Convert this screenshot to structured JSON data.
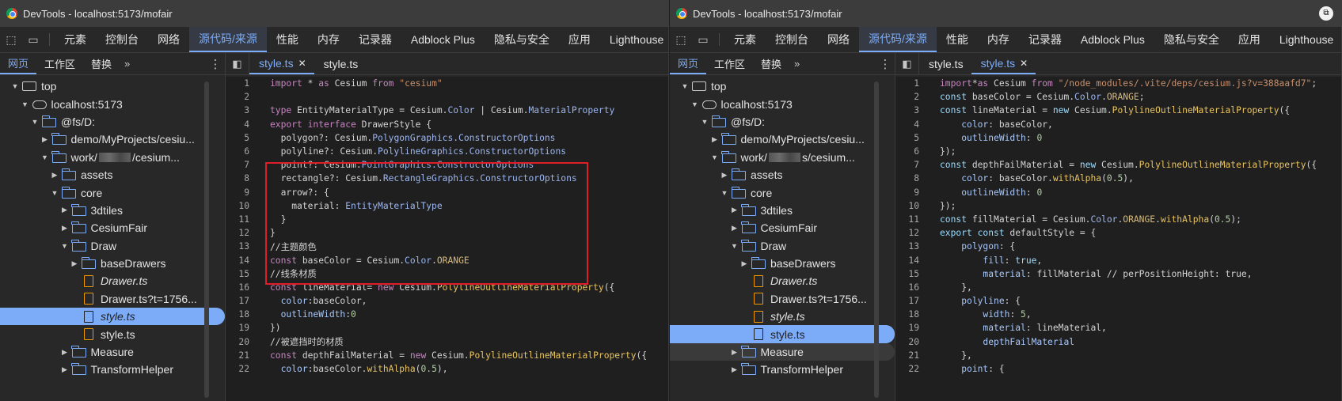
{
  "windows": [
    {
      "title": "DevTools - localhost:5173/mofair",
      "main_tabs": [
        "元素",
        "控制台",
        "网络",
        "源代码/来源",
        "性能",
        "内存",
        "记录器",
        "Adblock Plus",
        "隐私与安全",
        "应用",
        "Lighthouse"
      ],
      "active_main_tab": 3,
      "nav_tabs": [
        "网页",
        "工作区",
        "替换"
      ],
      "nav_more": "»",
      "tree": [
        {
          "indent": 0,
          "arrow": "▼",
          "icon": "frame",
          "label": "top"
        },
        {
          "indent": 1,
          "arrow": "▼",
          "icon": "cloud",
          "label": "localhost:5173"
        },
        {
          "indent": 2,
          "arrow": "▼",
          "icon": "folder",
          "label": "@fs/D:"
        },
        {
          "indent": 3,
          "arrow": "▶",
          "icon": "folder",
          "label": "demo/MyProjects/cesiu..."
        },
        {
          "indent": 3,
          "arrow": "▼",
          "icon": "folder",
          "label": "work/",
          "label_suffix": "/cesium...",
          "blurred": true
        },
        {
          "indent": 4,
          "arrow": "▶",
          "icon": "folder",
          "label": "assets"
        },
        {
          "indent": 4,
          "arrow": "▼",
          "icon": "folder",
          "label": "core"
        },
        {
          "indent": 5,
          "arrow": "▶",
          "icon": "folder",
          "label": "3dtiles"
        },
        {
          "indent": 5,
          "arrow": "▶",
          "icon": "folder",
          "label": "CesiumFair"
        },
        {
          "indent": 5,
          "arrow": "▼",
          "icon": "folder",
          "label": "Draw"
        },
        {
          "indent": 6,
          "arrow": "▶",
          "icon": "folder",
          "label": "baseDrawers"
        },
        {
          "indent": 6,
          "arrow": "",
          "icon": "file",
          "label": "Drawer.ts",
          "italic": true
        },
        {
          "indent": 6,
          "arrow": "",
          "icon": "file",
          "label": "Drawer.ts?t=1756..."
        },
        {
          "indent": 6,
          "arrow": "",
          "icon": "file",
          "label": "style.ts",
          "italic": true,
          "selected": true
        },
        {
          "indent": 6,
          "arrow": "",
          "icon": "file",
          "label": "style.ts"
        },
        {
          "indent": 5,
          "arrow": "▶",
          "icon": "folder",
          "label": "Measure"
        },
        {
          "indent": 5,
          "arrow": "▶",
          "icon": "folder",
          "label": "TransformHelper"
        }
      ],
      "editor_tabs": [
        {
          "label": "style.ts",
          "active": true,
          "closable": true
        },
        {
          "label": "style.ts",
          "active": false,
          "closable": false
        }
      ],
      "code": [
        {
          "n": "1",
          "t": [
            [
              "k",
              "import"
            ],
            [
              "c",
              " * "
            ],
            [
              "k",
              "as"
            ],
            [
              "c",
              " Cesium "
            ],
            [
              "k",
              "from"
            ],
            [
              "s",
              " \"cesium\""
            ]
          ]
        },
        {
          "n": "2",
          "t": []
        },
        {
          "n": "3",
          "t": [
            [
              "k",
              "type"
            ],
            [
              "c",
              " EntityMaterialType = Cesium."
            ],
            [
              "ty",
              "Color"
            ],
            [
              "c",
              " | Cesium."
            ],
            [
              "ty",
              "MaterialProperty"
            ]
          ]
        },
        {
          "n": "4",
          "t": [
            [
              "k",
              "export interface"
            ],
            [
              "c",
              " DrawerStyle {"
            ]
          ]
        },
        {
          "n": "5",
          "t": [
            [
              "c",
              "  polygon?: Cesium."
            ],
            [
              "ty",
              "PolygonGraphics.ConstructorOptions"
            ]
          ]
        },
        {
          "n": "6",
          "t": [
            [
              "c",
              "  polyline?: Cesium."
            ],
            [
              "ty",
              "PolylineGraphics.ConstructorOptions"
            ]
          ]
        },
        {
          "n": "7",
          "t": [
            [
              "c",
              "  point?: Cesium."
            ],
            [
              "ty",
              "PointGraphics.ConstructorOptions"
            ]
          ]
        },
        {
          "n": "8",
          "t": [
            [
              "c",
              "  rectangle?: Cesium."
            ],
            [
              "ty",
              "RectangleGraphics.ConstructorOptions"
            ]
          ]
        },
        {
          "n": "9",
          "t": [
            [
              "c",
              "  arrow?: {"
            ]
          ]
        },
        {
          "n": "10",
          "t": [
            [
              "c",
              "    material: "
            ],
            [
              "ty",
              "EntityMaterialType"
            ]
          ]
        },
        {
          "n": "11",
          "t": [
            [
              "c",
              "  }"
            ]
          ]
        },
        {
          "n": "12",
          "t": [
            [
              "c",
              "}"
            ]
          ]
        },
        {
          "n": "13",
          "t": [
            [
              "c",
              "//主题颜色"
            ]
          ]
        },
        {
          "n": "14",
          "t": [
            [
              "k",
              "const"
            ],
            [
              "c",
              " baseColor = Cesium."
            ],
            [
              "ty",
              "Color"
            ],
            [
              "c",
              "."
            ],
            [
              "p",
              "ORANGE"
            ]
          ]
        },
        {
          "n": "15",
          "t": [
            [
              "c",
              "//线条材质"
            ]
          ]
        },
        {
          "n": "16",
          "t": [
            [
              "k",
              "const"
            ],
            [
              "c",
              " lineMaterial= "
            ],
            [
              "k",
              "new"
            ],
            [
              "c",
              " Cesium."
            ],
            [
              "cls",
              "PolylineOutlineMaterialProperty"
            ],
            [
              "c",
              "({"
            ]
          ]
        },
        {
          "n": "17",
          "t": [
            [
              "c",
              "  "
            ],
            [
              "pr",
              "color"
            ],
            [
              "c",
              ":baseColor,"
            ]
          ]
        },
        {
          "n": "18",
          "t": [
            [
              "c",
              "  "
            ],
            [
              "pr",
              "outlineWidth"
            ],
            [
              "c",
              ":"
            ],
            [
              "n",
              "0"
            ]
          ]
        },
        {
          "n": "19",
          "t": [
            [
              "c",
              "})"
            ]
          ]
        },
        {
          "n": "20",
          "t": [
            [
              "c",
              "//被遮挡时的材质"
            ]
          ]
        },
        {
          "n": "21",
          "t": [
            [
              "k",
              "const"
            ],
            [
              "c",
              " depthFailMaterial = "
            ],
            [
              "k",
              "new"
            ],
            [
              "c",
              " Cesium."
            ],
            [
              "cls",
              "PolylineOutlineMaterialProperty"
            ],
            [
              "c",
              "({"
            ]
          ]
        },
        {
          "n": "22",
          "t": [
            [
              "c",
              "  "
            ],
            [
              "pr",
              "color"
            ],
            [
              "c",
              ":baseColor."
            ],
            [
              "cls",
              "withAlpha"
            ],
            [
              "c",
              "("
            ],
            [
              "n",
              "0.5"
            ],
            [
              "c",
              "),"
            ]
          ]
        }
      ]
    },
    {
      "title": "DevTools - localhost:5173/mofair",
      "main_tabs": [
        "元素",
        "控制台",
        "网络",
        "源代码/来源",
        "性能",
        "内存",
        "记录器",
        "Adblock Plus",
        "隐私与安全",
        "应用",
        "Lighthouse"
      ],
      "active_main_tab": 3,
      "nav_tabs": [
        "网页",
        "工作区",
        "替换"
      ],
      "nav_more": "»",
      "tree": [
        {
          "indent": 0,
          "arrow": "▼",
          "icon": "frame",
          "label": "top"
        },
        {
          "indent": 1,
          "arrow": "▼",
          "icon": "cloud",
          "label": "localhost:5173"
        },
        {
          "indent": 2,
          "arrow": "▼",
          "icon": "folder",
          "label": "@fs/D:"
        },
        {
          "indent": 3,
          "arrow": "▶",
          "icon": "folder",
          "label": "demo/MyProjects/cesiu..."
        },
        {
          "indent": 3,
          "arrow": "▼",
          "icon": "folder",
          "label": "work/",
          "label_suffix": "s/cesium...",
          "blurred": true
        },
        {
          "indent": 4,
          "arrow": "▶",
          "icon": "folder",
          "label": "assets"
        },
        {
          "indent": 4,
          "arrow": "▼",
          "icon": "folder",
          "label": "core"
        },
        {
          "indent": 5,
          "arrow": "▶",
          "icon": "folder",
          "label": "3dtiles"
        },
        {
          "indent": 5,
          "arrow": "▶",
          "icon": "folder",
          "label": "CesiumFair"
        },
        {
          "indent": 5,
          "arrow": "▼",
          "icon": "folder",
          "label": "Draw"
        },
        {
          "indent": 6,
          "arrow": "▶",
          "icon": "folder",
          "label": "baseDrawers"
        },
        {
          "indent": 6,
          "arrow": "",
          "icon": "file",
          "label": "Drawer.ts",
          "italic": true
        },
        {
          "indent": 6,
          "arrow": "",
          "icon": "file",
          "label": "Drawer.ts?t=1756..."
        },
        {
          "indent": 6,
          "arrow": "",
          "icon": "file",
          "label": "style.ts",
          "italic": true
        },
        {
          "indent": 6,
          "arrow": "",
          "icon": "file-plain",
          "label": "style.ts",
          "selected": true
        },
        {
          "indent": 5,
          "arrow": "▶",
          "icon": "folder",
          "label": "Measure",
          "hovered": true
        },
        {
          "indent": 5,
          "arrow": "▶",
          "icon": "folder",
          "label": "TransformHelper"
        }
      ],
      "editor_tabs": [
        {
          "label": "style.ts",
          "active": false,
          "closable": false
        },
        {
          "label": "style.ts",
          "active": true,
          "closable": true
        }
      ],
      "code": [
        {
          "n": "1",
          "t": [
            [
              "k",
              "import"
            ],
            [
              "c",
              "*"
            ],
            [
              "k",
              "as"
            ],
            [
              "c",
              " Cesium "
            ],
            [
              "k",
              "from"
            ],
            [
              "s",
              " \"/node_modules/.vite/deps/cesium.js?v=388aafd7\""
            ],
            [
              "c",
              ";"
            ]
          ]
        },
        {
          "n": "2",
          "t": [
            [
              "k2",
              "const"
            ],
            [
              "c",
              " baseColor = Cesium."
            ],
            [
              "ty",
              "Color"
            ],
            [
              "c",
              "."
            ],
            [
              "p",
              "ORANGE"
            ],
            [
              "c",
              ";"
            ]
          ]
        },
        {
          "n": "3",
          "t": [
            [
              "k2",
              "const"
            ],
            [
              "c",
              " lineMaterial = "
            ],
            [
              "k2",
              "new"
            ],
            [
              "c",
              " Cesium."
            ],
            [
              "cls",
              "PolylineOutlineMaterialProperty"
            ],
            [
              "c",
              "({"
            ]
          ]
        },
        {
          "n": "4",
          "t": [
            [
              "c",
              "    "
            ],
            [
              "pr",
              "color"
            ],
            [
              "c",
              ": baseColor,"
            ]
          ]
        },
        {
          "n": "5",
          "t": [
            [
              "c",
              "    "
            ],
            [
              "pr",
              "outlineWidth"
            ],
            [
              "c",
              ": "
            ],
            [
              "n",
              "0"
            ]
          ]
        },
        {
          "n": "6",
          "t": [
            [
              "c",
              "});"
            ]
          ]
        },
        {
          "n": "7",
          "t": [
            [
              "k2",
              "const"
            ],
            [
              "c",
              " depthFailMaterial = "
            ],
            [
              "k2",
              "new"
            ],
            [
              "c",
              " Cesium."
            ],
            [
              "cls",
              "PolylineOutlineMaterialProperty"
            ],
            [
              "c",
              "({"
            ]
          ]
        },
        {
          "n": "8",
          "t": [
            [
              "c",
              "    "
            ],
            [
              "pr",
              "color"
            ],
            [
              "c",
              ": baseColor."
            ],
            [
              "cls",
              "withAlpha"
            ],
            [
              "c",
              "("
            ],
            [
              "n",
              "0.5"
            ],
            [
              "c",
              "),"
            ]
          ]
        },
        {
          "n": "9",
          "t": [
            [
              "c",
              "    "
            ],
            [
              "pr",
              "outlineWidth"
            ],
            [
              "c",
              ": "
            ],
            [
              "n",
              "0"
            ]
          ]
        },
        {
          "n": "10",
          "t": [
            [
              "c",
              "});"
            ]
          ]
        },
        {
          "n": "11",
          "t": [
            [
              "k2",
              "const"
            ],
            [
              "c",
              " fillMaterial = Cesium."
            ],
            [
              "ty",
              "Color"
            ],
            [
              "c",
              "."
            ],
            [
              "p",
              "ORANGE"
            ],
            [
              "c",
              "."
            ],
            [
              "cls",
              "withAlpha"
            ],
            [
              "c",
              "("
            ],
            [
              "n",
              "0.5"
            ],
            [
              "c",
              ");"
            ]
          ]
        },
        {
          "n": "12",
          "t": [
            [
              "k2",
              "export const"
            ],
            [
              "c",
              " defaultStyle = {"
            ]
          ]
        },
        {
          "n": "13",
          "t": [
            [
              "c",
              "    "
            ],
            [
              "pr",
              "polygon"
            ],
            [
              "c",
              ": {"
            ]
          ]
        },
        {
          "n": "14",
          "t": [
            [
              "c",
              "        "
            ],
            [
              "pr",
              "fill"
            ],
            [
              "c",
              ": "
            ],
            [
              "k2",
              "true"
            ],
            [
              "c",
              ","
            ]
          ]
        },
        {
          "n": "15",
          "t": [
            [
              "c",
              "        "
            ],
            [
              "pr",
              "material"
            ],
            [
              "c",
              ": fillMaterial // perPositionHeight: true,"
            ]
          ]
        },
        {
          "n": "16",
          "t": [
            [
              "c",
              "    },"
            ]
          ]
        },
        {
          "n": "17",
          "t": [
            [
              "c",
              "    "
            ],
            [
              "pr",
              "polyline"
            ],
            [
              "c",
              ": {"
            ]
          ]
        },
        {
          "n": "18",
          "t": [
            [
              "c",
              "        "
            ],
            [
              "pr",
              "width"
            ],
            [
              "c",
              ": "
            ],
            [
              "n",
              "5"
            ],
            [
              "c",
              ","
            ]
          ]
        },
        {
          "n": "19",
          "t": [
            [
              "c",
              "        "
            ],
            [
              "pr",
              "material"
            ],
            [
              "c",
              ": lineMaterial,"
            ]
          ]
        },
        {
          "n": "20",
          "t": [
            [
              "c",
              "        "
            ],
            [
              "pr",
              "depthFailMaterial"
            ]
          ]
        },
        {
          "n": "21",
          "t": [
            [
              "c",
              "    },"
            ]
          ]
        },
        {
          "n": "22",
          "t": [
            [
              "c",
              "    "
            ],
            [
              "pr",
              "point"
            ],
            [
              "c",
              ": {"
            ]
          ]
        }
      ]
    }
  ]
}
